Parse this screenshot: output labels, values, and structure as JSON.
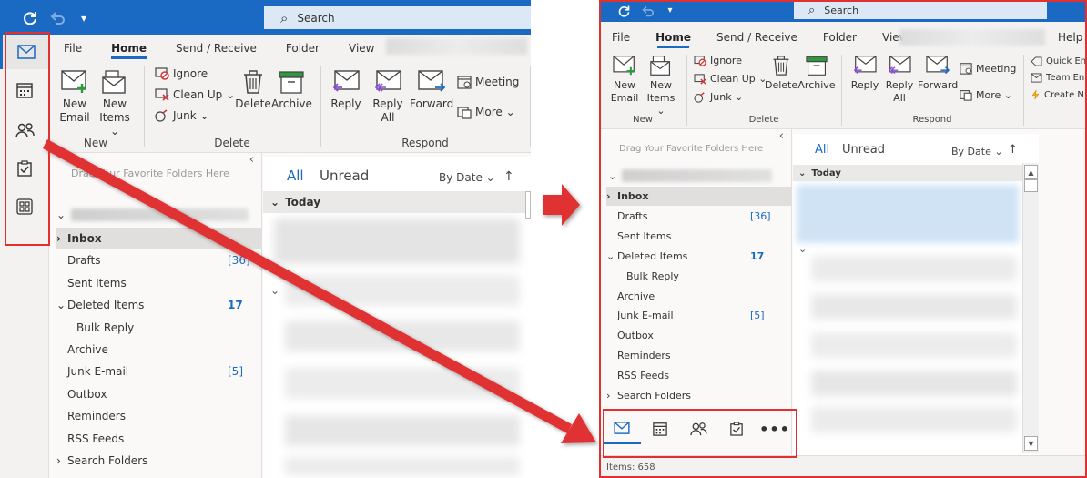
{
  "window": {
    "search_placeholder": "Search",
    "menu_tabs": [
      "File",
      "Home",
      "Send / Receive",
      "Folder",
      "View"
    ],
    "menu_tab_extra": "Help",
    "active_tab": "Home"
  },
  "ribbon": {
    "new_email": [
      "New",
      "Email"
    ],
    "new_items": [
      "New",
      "Items ⌄"
    ],
    "ignore": "Ignore",
    "clean_up": "Clean Up ⌄",
    "junk": "Junk ⌄",
    "delete": "Delete",
    "archive": "Archive",
    "reply": "Reply",
    "reply_all": [
      "Reply",
      "All"
    ],
    "forward": "Forward",
    "meeting": "Meeting",
    "more": "More ⌄",
    "quick_steps": [
      "Quick En",
      "Team En",
      "Create N"
    ],
    "groups": {
      "new": "New",
      "delete": "Delete",
      "respond": "Respond"
    }
  },
  "navigation": {
    "rail_icons": [
      "mail-icon",
      "calendar-icon",
      "people-icon",
      "tasks-icon",
      "apps-icon"
    ],
    "bottom_icons": [
      "mail-icon",
      "calendar-icon",
      "people-icon",
      "tasks-icon",
      "more-icon"
    ]
  },
  "folders": {
    "favorites_hint": "Drag Your Favorite Folders Here",
    "items": [
      {
        "name": "Inbox",
        "prefix": "›",
        "indent": 0,
        "count": "",
        "selected": true
      },
      {
        "name": "Drafts",
        "prefix": "",
        "indent": 1,
        "count": "[36]",
        "selected": false
      },
      {
        "name": "Sent Items",
        "prefix": "",
        "indent": 1,
        "count": "",
        "selected": false
      },
      {
        "name": "Deleted Items",
        "prefix": "⌄",
        "indent": 0,
        "count": "17",
        "selected": false
      },
      {
        "name": "Bulk Reply",
        "prefix": "",
        "indent": 2,
        "count": "",
        "selected": false
      },
      {
        "name": "Archive",
        "prefix": "",
        "indent": 1,
        "count": "",
        "selected": false
      },
      {
        "name": "Junk E-mail",
        "prefix": "",
        "indent": 1,
        "count": "[5]",
        "selected": false
      },
      {
        "name": "Outbox",
        "prefix": "",
        "indent": 1,
        "count": "",
        "selected": false
      },
      {
        "name": "Reminders",
        "prefix": "",
        "indent": 1,
        "count": "",
        "selected": false
      },
      {
        "name": "RSS Feeds",
        "prefix": "",
        "indent": 1,
        "count": "",
        "selected": false
      },
      {
        "name": "Search Folders",
        "prefix": "›",
        "indent": 0,
        "count": "",
        "selected": false
      }
    ]
  },
  "message_list": {
    "tab_all": "All",
    "tab_unread": "Unread",
    "sort": "By Date ⌄",
    "sort_dir": "↑",
    "group_today": "Today"
  },
  "status": {
    "items": "Items: 658"
  },
  "colors": {
    "accent": "#1a69c2",
    "highlight": "#e03030",
    "titlebar": "#1a69c2"
  }
}
